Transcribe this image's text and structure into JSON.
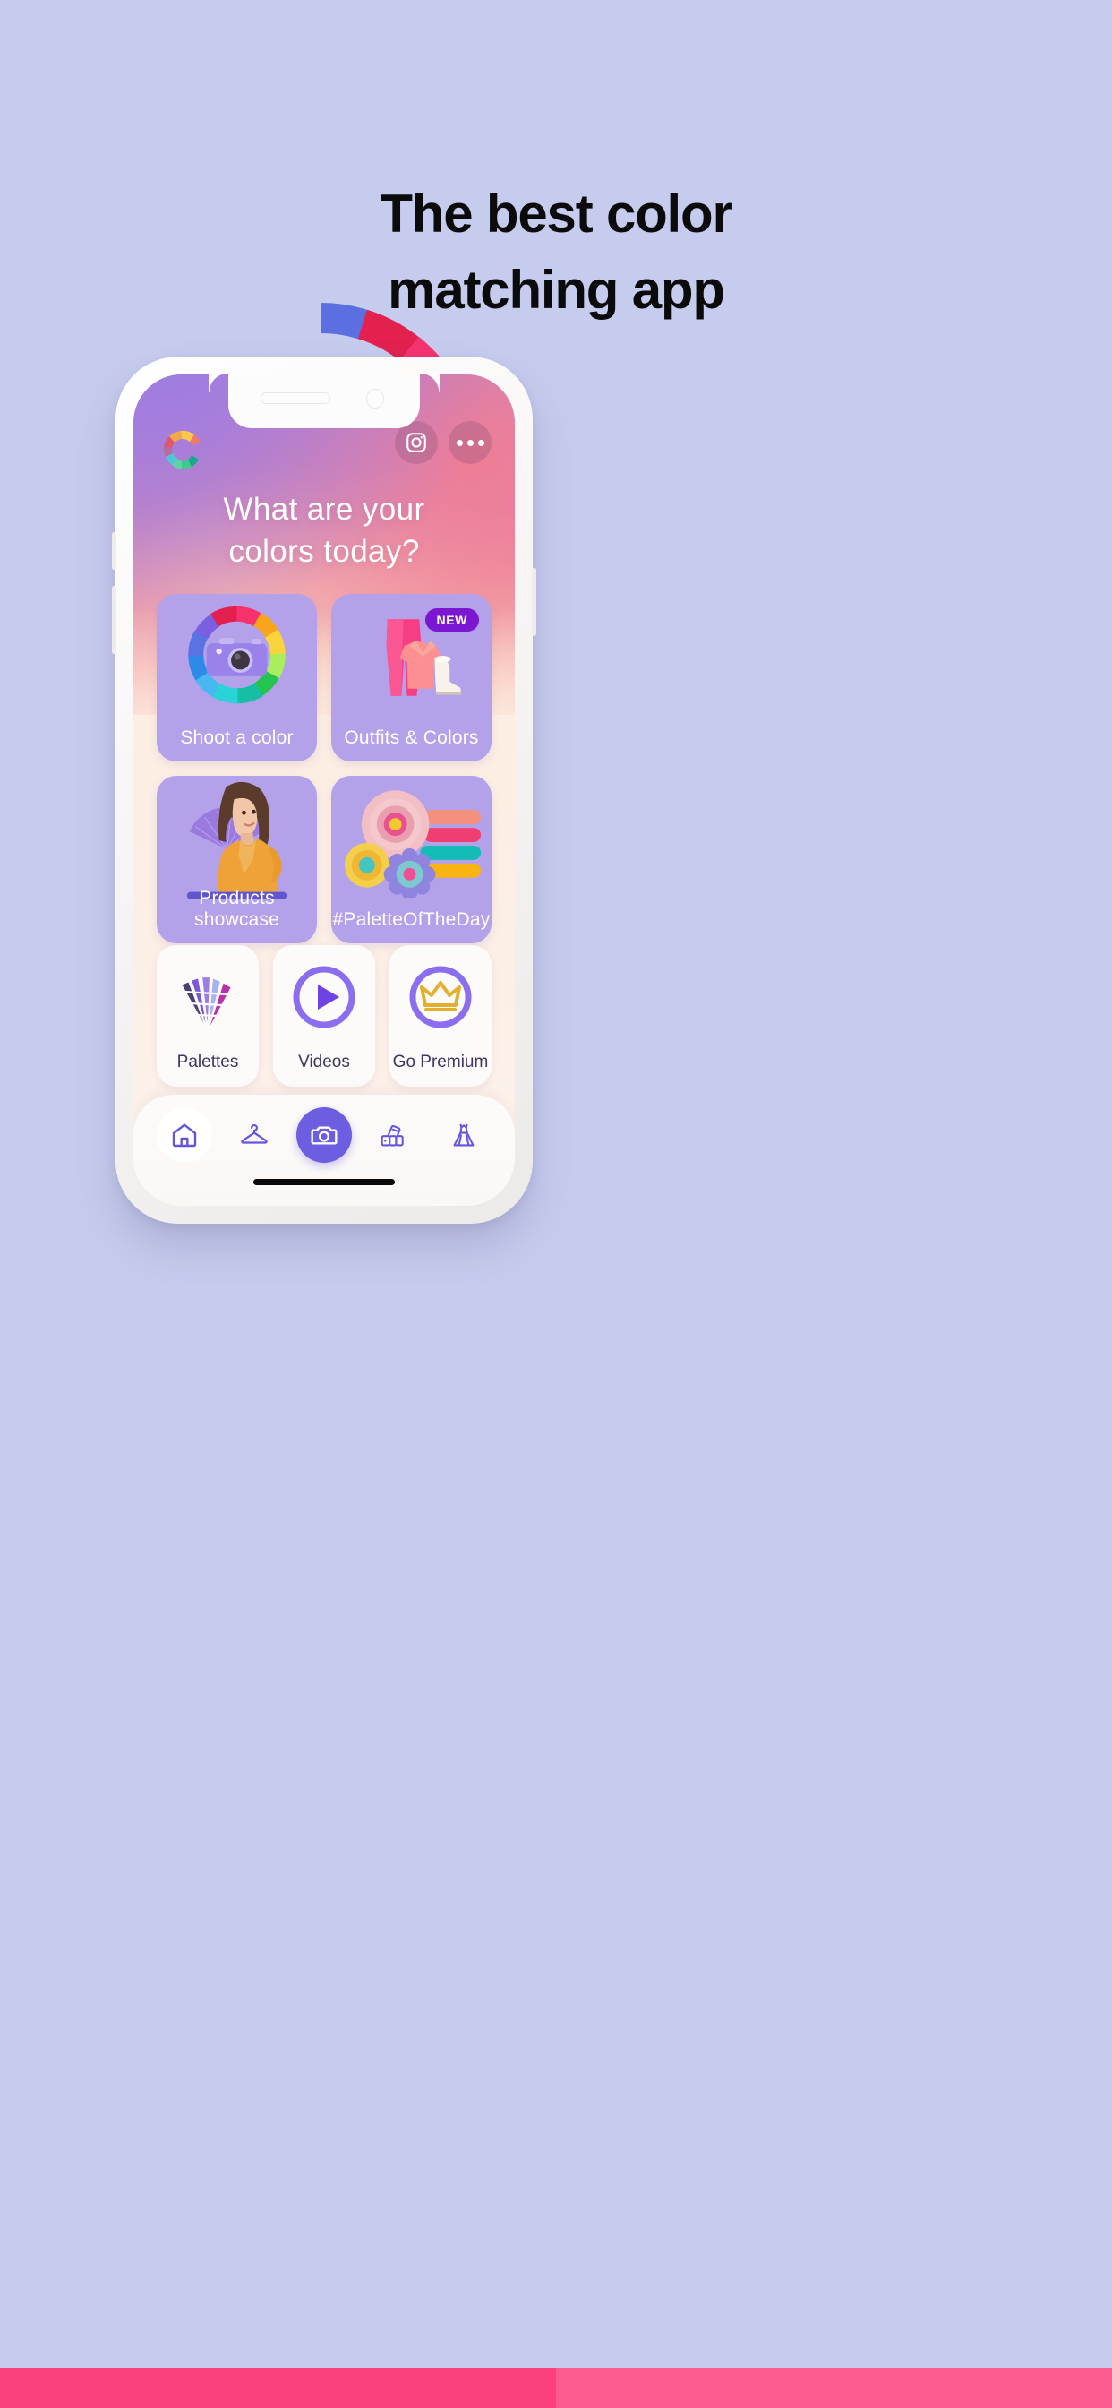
{
  "page": {
    "background_color": "#c6ccee",
    "headline": "The best color\nmatching app",
    "headline_line1": "The best color",
    "headline_line2": "matching app"
  },
  "color_arc": {
    "segments": [
      "#e2214f",
      "#f4346e",
      "#f9366f",
      "#f9a31b",
      "#f8c22c",
      "#fbd13c",
      "#b4f05a",
      "#8ed44f",
      "#1fc04a",
      "#17b77c",
      "#13b0ba"
    ]
  },
  "phone": {
    "status": {
      "speaker": "speaker-slot",
      "front_camera": "front-camera"
    },
    "top_bar": {
      "logo": "color-wheel-logo",
      "instagram_label": "instagram-icon",
      "more_label": "more-options-icon"
    },
    "hero": {
      "line1": "What are your",
      "line2": "colors today?"
    },
    "cards": [
      {
        "label": "Shoot a color",
        "icon": "color-wheel-camera-icon",
        "badge": null
      },
      {
        "label": "Outfits & Colors",
        "icon": "outfit-icon",
        "badge": "NEW"
      },
      {
        "label": "Products showcase",
        "icon": "model-photo-icon",
        "badge": null
      },
      {
        "label": "#PaletteOfTheDay",
        "icon": "flowers-palette-icon",
        "badge": null
      }
    ],
    "small_cards": [
      {
        "label": "Palettes",
        "icon": "swatch-fan-icon"
      },
      {
        "label": "Videos",
        "icon": "play-circle-icon"
      },
      {
        "label": "Go Premium",
        "icon": "crown-icon"
      }
    ],
    "nav": [
      {
        "name": "home",
        "icon": "home-icon",
        "active": true
      },
      {
        "name": "wardrobe",
        "icon": "hanger-icon",
        "active": false
      },
      {
        "name": "camera",
        "icon": "camera-icon",
        "active": true
      },
      {
        "name": "palettes",
        "icon": "swatches-icon",
        "active": false
      },
      {
        "name": "outfits",
        "icon": "dress-icon",
        "active": false
      }
    ],
    "palette_of_the_day_colors": [
      "#f4907e",
      "#ef3f72",
      "#13bcb6",
      "#f9b312"
    ],
    "accent_color": "#6d5de0",
    "card_color": "#b3a1ea",
    "badge_color": "#7b17d1"
  }
}
